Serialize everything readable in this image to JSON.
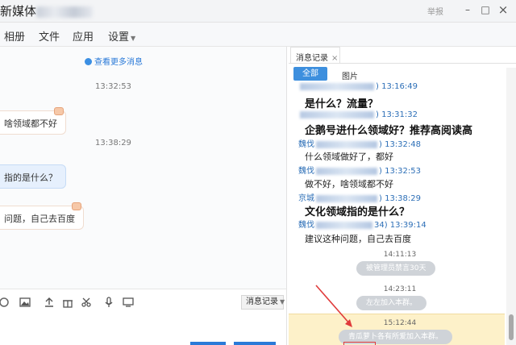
{
  "window": {
    "title": "新媒体",
    "report_label": "举报",
    "minimize": "–",
    "maximize": "□",
    "close": "×"
  },
  "menu": {
    "items": [
      "相册",
      "文件",
      "应用",
      "设置"
    ]
  },
  "chat": {
    "more_messages": "查看更多消息",
    "timestamps": [
      "13:32:53",
      "13:38:29"
    ],
    "bubbles": [
      "啥领域都不好",
      "指的是什么？",
      "问题，自己去百度"
    ],
    "message_history_button": "消息记录"
  },
  "history": {
    "tab_label": "消息记录",
    "tab_close": "×",
    "filter_all": "全部",
    "filter_pictures": "图片",
    "messages": [
      {
        "prefix": "",
        "suffix": ") 13:16:49",
        "text": "是什么？流量？",
        "style": "big"
      },
      {
        "prefix": "",
        "suffix": ") 13:31:32",
        "text": "企鹅号进什么领域好？推荐高阅读高",
        "style": "big"
      },
      {
        "prefix": "魏伐",
        "suffix": ") 13:32:48",
        "text": "什么领域做好了，都好",
        "style": "small"
      },
      {
        "prefix": "魏伐",
        "suffix": ") 13:32:53",
        "text": "做不好，啥领域都不好",
        "style": "small"
      },
      {
        "prefix": "京城",
        "suffix": ") 13:38:29",
        "text": "文化领域指的是什么？",
        "style": "big"
      },
      {
        "prefix": "魏伐",
        "suffix": "34) 13:39:14",
        "text": "建议这种问题，自己去百度",
        "style": "small"
      }
    ],
    "system_events": [
      {
        "time": "14:11:13",
        "text": "被管理员禁言30天"
      },
      {
        "time": "14:23:11",
        "text": "左左加入本群。"
      },
      {
        "time": "15:12:44",
        "text": "青瓜萝卜各有所爱加入本群。"
      }
    ]
  },
  "colors": {
    "accent": "#3d8fde",
    "link": "#2a7ad8",
    "highlight": "#fdf1c9",
    "annotation": "#e03b3b"
  }
}
